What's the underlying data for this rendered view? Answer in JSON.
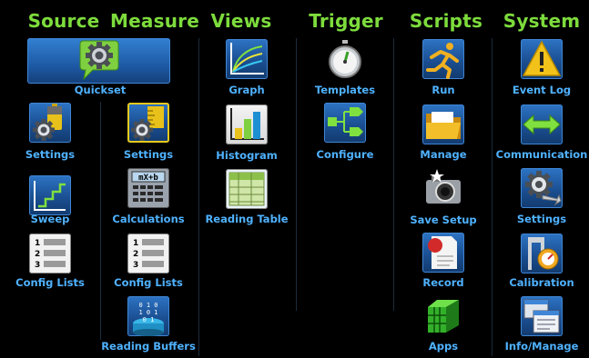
{
  "headers": {
    "source": "Source",
    "measure": "Measure",
    "views": "Views",
    "trigger": "Trigger",
    "scripts": "Scripts",
    "system": "System"
  },
  "quickset": {
    "label": "Quickset",
    "icon": "gear-speech-icon"
  },
  "source": {
    "settings": "Settings",
    "sweep": "Sweep",
    "config_lists": "Config Lists"
  },
  "measure": {
    "settings": "Settings",
    "calculations": "Calculations",
    "config_lists": "Config Lists",
    "reading_buffers": "Reading Buffers"
  },
  "views": {
    "graph": "Graph",
    "histogram": "Histogram",
    "reading_table": "Reading Table"
  },
  "trigger": {
    "templates": "Templates",
    "configure": "Configure"
  },
  "scripts": {
    "run": "Run",
    "manage": "Manage",
    "save_setup": "Save Setup",
    "record": "Record",
    "apps": "Apps"
  },
  "system": {
    "event_log": "Event Log",
    "communication": "Communication",
    "settings": "Settings",
    "calibration": "Calibration",
    "info_manage": "Info/Manage"
  },
  "calc_formula": "mX+b",
  "colors": {
    "header": "#7ddc3c",
    "label": "#4fb2ff",
    "tile": "#1e5aa5",
    "selected_border": "#e7c81e"
  }
}
